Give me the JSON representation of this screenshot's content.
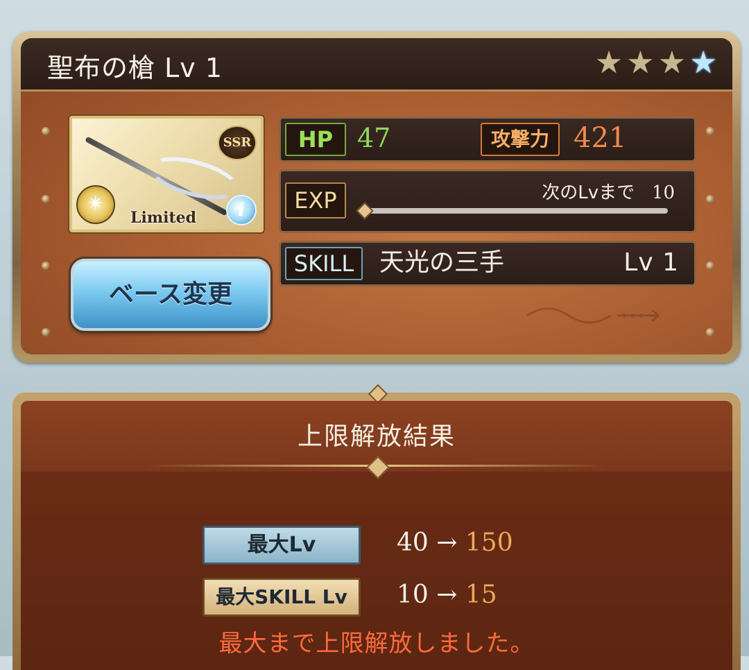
{
  "weapon": {
    "title": "聖布の槍 Lv 1",
    "rarity_badge": "SSR",
    "limited_label": "Limited",
    "info_icon": "i",
    "stars": [
      "★",
      "★",
      "★",
      "★"
    ]
  },
  "stats": {
    "hp_label": "HP",
    "hp_value": "47",
    "atk_label": "攻撃力",
    "atk_value": "421",
    "exp_label": "EXP",
    "exp_next_text": "次のLvまで",
    "exp_next_value": "10",
    "exp_progress": 0.0,
    "skill_label": "SKILL",
    "skill_name": "天光の三手",
    "skill_level": "Lv 1"
  },
  "base_change_button": "ベース変更",
  "result_panel": {
    "title": "上限解放結果",
    "max_lv_label": "最大Lv",
    "max_lv_from": "40",
    "arrow": "→",
    "max_lv_to": "150",
    "max_skill_label": "最大SKILL Lv",
    "max_skill_from": "10",
    "max_skill_to": "15",
    "message": "最大まで上限解放しました。"
  },
  "colors": {
    "hp_green": "#8fd95a",
    "atk_orange": "#f08a4f",
    "new_value_gold": "#f0a85a",
    "message_red": "#ff6a3d",
    "blue_star": "#bde6ff"
  }
}
